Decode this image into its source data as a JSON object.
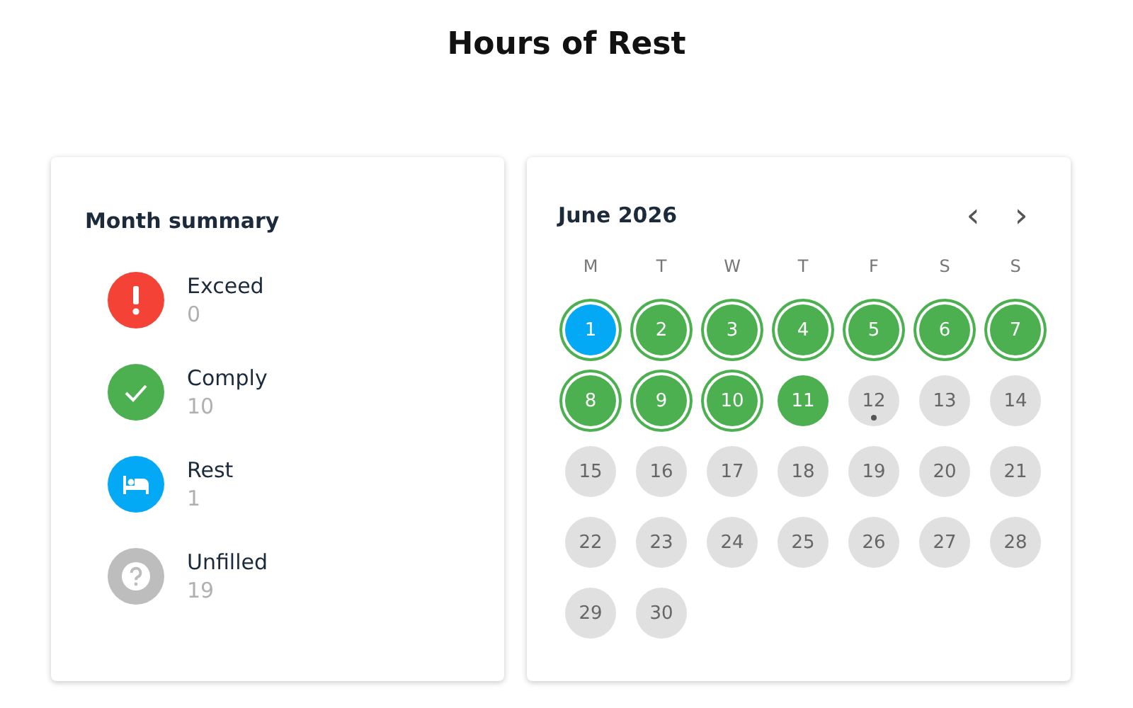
{
  "title": "Hours of Rest",
  "summary": {
    "title": "Month summary",
    "items": [
      {
        "kind": "exceed",
        "label": "Exceed",
        "count": "0"
      },
      {
        "kind": "comply",
        "label": "Comply",
        "count": "10"
      },
      {
        "kind": "rest",
        "label": "Rest",
        "count": "1"
      },
      {
        "kind": "unfilled",
        "label": "Unfilled",
        "count": "19"
      }
    ]
  },
  "calendar": {
    "month": "June 2026",
    "prev": "‹",
    "next": "›",
    "weekdays": [
      "M",
      "T",
      "W",
      "T",
      "F",
      "S",
      "S"
    ],
    "days": [
      {
        "day": "1",
        "kind": "rest",
        "ringed": true,
        "marked": false
      },
      {
        "day": "2",
        "kind": "comply",
        "ringed": true,
        "marked": false
      },
      {
        "day": "3",
        "kind": "comply",
        "ringed": true,
        "marked": false
      },
      {
        "day": "4",
        "kind": "comply",
        "ringed": true,
        "marked": false
      },
      {
        "day": "5",
        "kind": "comply",
        "ringed": true,
        "marked": false
      },
      {
        "day": "6",
        "kind": "comply",
        "ringed": true,
        "marked": false
      },
      {
        "day": "7",
        "kind": "comply",
        "ringed": true,
        "marked": false
      },
      {
        "day": "8",
        "kind": "comply",
        "ringed": true,
        "marked": false
      },
      {
        "day": "9",
        "kind": "comply",
        "ringed": true,
        "marked": false
      },
      {
        "day": "10",
        "kind": "comply",
        "ringed": true,
        "marked": false
      },
      {
        "day": "11",
        "kind": "comply",
        "ringed": false,
        "marked": false
      },
      {
        "day": "12",
        "kind": "unfilled",
        "ringed": false,
        "marked": true
      },
      {
        "day": "13",
        "kind": "unfilled",
        "ringed": false,
        "marked": false
      },
      {
        "day": "14",
        "kind": "unfilled",
        "ringed": false,
        "marked": false
      },
      {
        "day": "15",
        "kind": "unfilled",
        "ringed": false,
        "marked": false
      },
      {
        "day": "16",
        "kind": "unfilled",
        "ringed": false,
        "marked": false
      },
      {
        "day": "17",
        "kind": "unfilled",
        "ringed": false,
        "marked": false
      },
      {
        "day": "18",
        "kind": "unfilled",
        "ringed": false,
        "marked": false
      },
      {
        "day": "19",
        "kind": "unfilled",
        "ringed": false,
        "marked": false
      },
      {
        "day": "20",
        "kind": "unfilled",
        "ringed": false,
        "marked": false
      },
      {
        "day": "21",
        "kind": "unfilled",
        "ringed": false,
        "marked": false
      },
      {
        "day": "22",
        "kind": "unfilled",
        "ringed": false,
        "marked": false
      },
      {
        "day": "23",
        "kind": "unfilled",
        "ringed": false,
        "marked": false
      },
      {
        "day": "24",
        "kind": "unfilled",
        "ringed": false,
        "marked": false
      },
      {
        "day": "25",
        "kind": "unfilled",
        "ringed": false,
        "marked": false
      },
      {
        "day": "26",
        "kind": "unfilled",
        "ringed": false,
        "marked": false
      },
      {
        "day": "27",
        "kind": "unfilled",
        "ringed": false,
        "marked": false
      },
      {
        "day": "28",
        "kind": "unfilled",
        "ringed": false,
        "marked": false
      },
      {
        "day": "29",
        "kind": "unfilled",
        "ringed": false,
        "marked": false
      },
      {
        "day": "30",
        "kind": "unfilled",
        "ringed": false,
        "marked": false
      }
    ]
  }
}
